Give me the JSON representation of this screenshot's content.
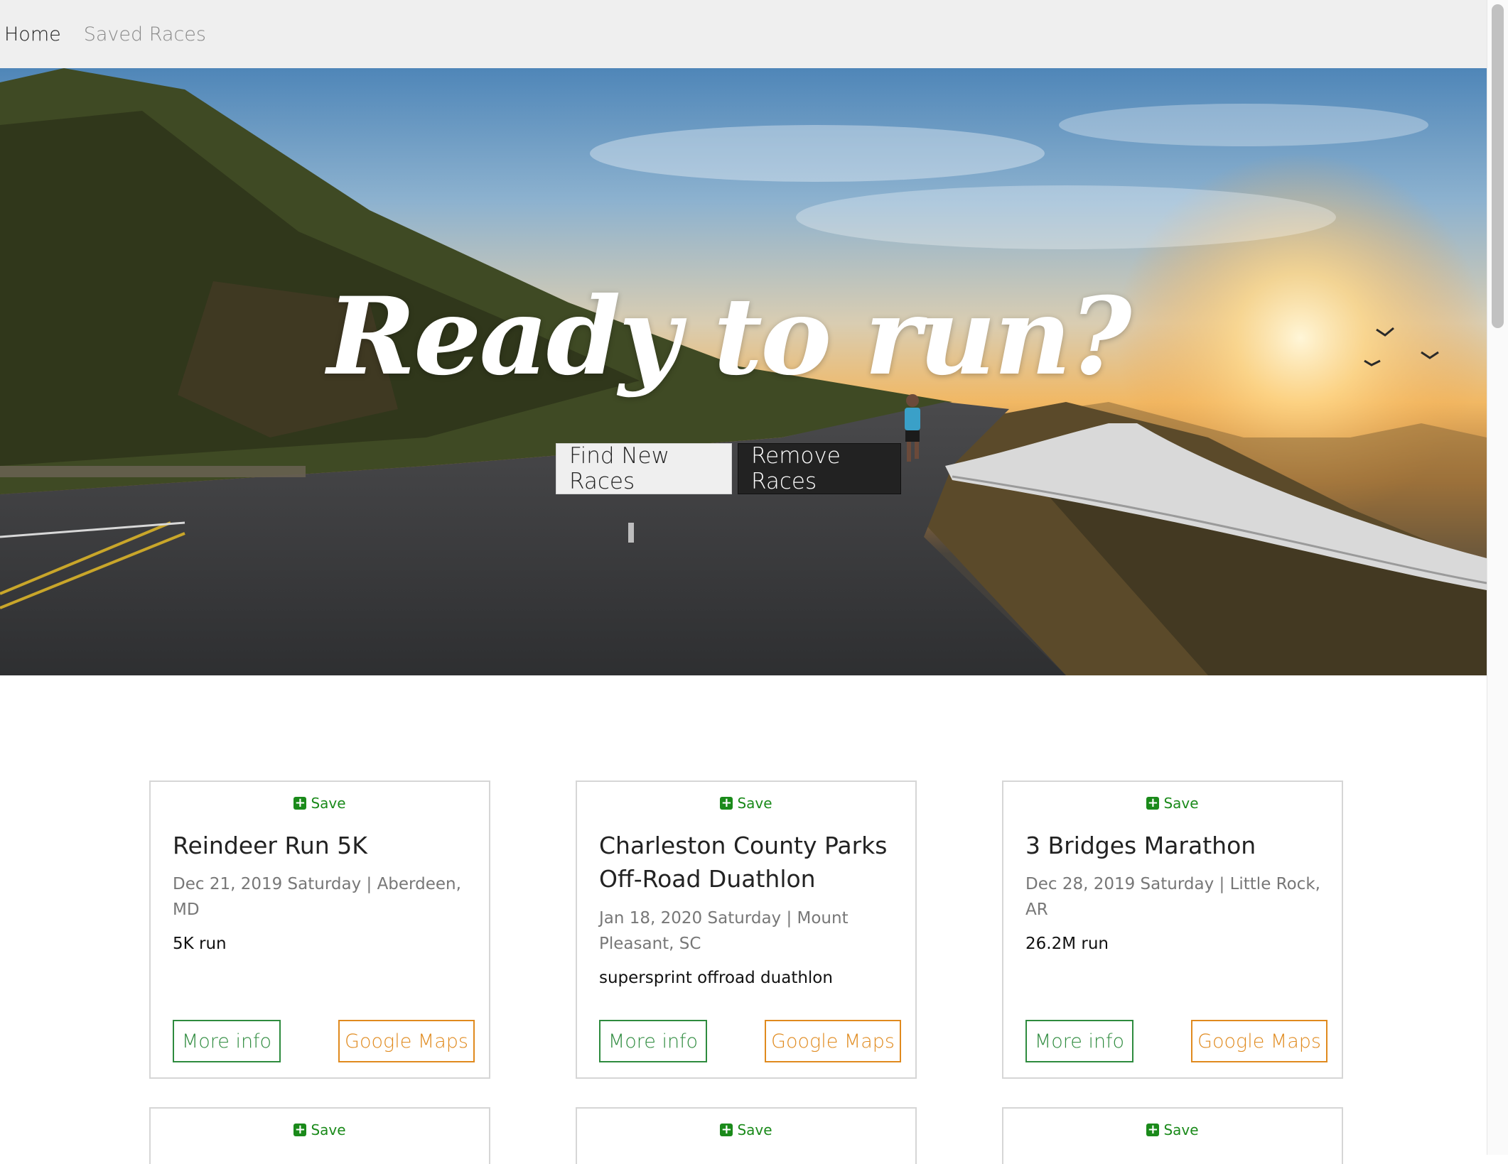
{
  "nav": {
    "home": "Home",
    "saved": "Saved Races"
  },
  "hero": {
    "title": "Ready to run?",
    "find_button": "Find New Races",
    "remove_button": "Remove Races"
  },
  "cards": [
    {
      "save_label": "Save",
      "title": "Reindeer Run 5K",
      "meta": "Dec 21, 2019 Saturday | Aberdeen, MD",
      "description": "5K run",
      "more_info": "More info",
      "maps": "Google Maps"
    },
    {
      "save_label": "Save",
      "title": "Charleston County Parks Off-Road Duathlon",
      "meta": "Jan 18, 2020 Saturday | Mount Pleasant, SC",
      "description": "supersprint offroad duathlon",
      "more_info": "More info",
      "maps": "Google Maps"
    },
    {
      "save_label": "Save",
      "title": "3 Bridges Marathon",
      "meta": "Dec 28, 2019 Saturday | Little Rock, AR",
      "description": "26.2M run",
      "more_info": "More info",
      "maps": "Google Maps"
    },
    {
      "save_label": "Save"
    },
    {
      "save_label": "Save"
    },
    {
      "save_label": "Save"
    }
  ],
  "colors": {
    "save_green": "#1a8a1a",
    "info_green": "#2e8b3e",
    "maps_orange": "#e08a1e",
    "dark_button": "#222222"
  },
  "icons": {
    "save": "plus-square-icon"
  }
}
